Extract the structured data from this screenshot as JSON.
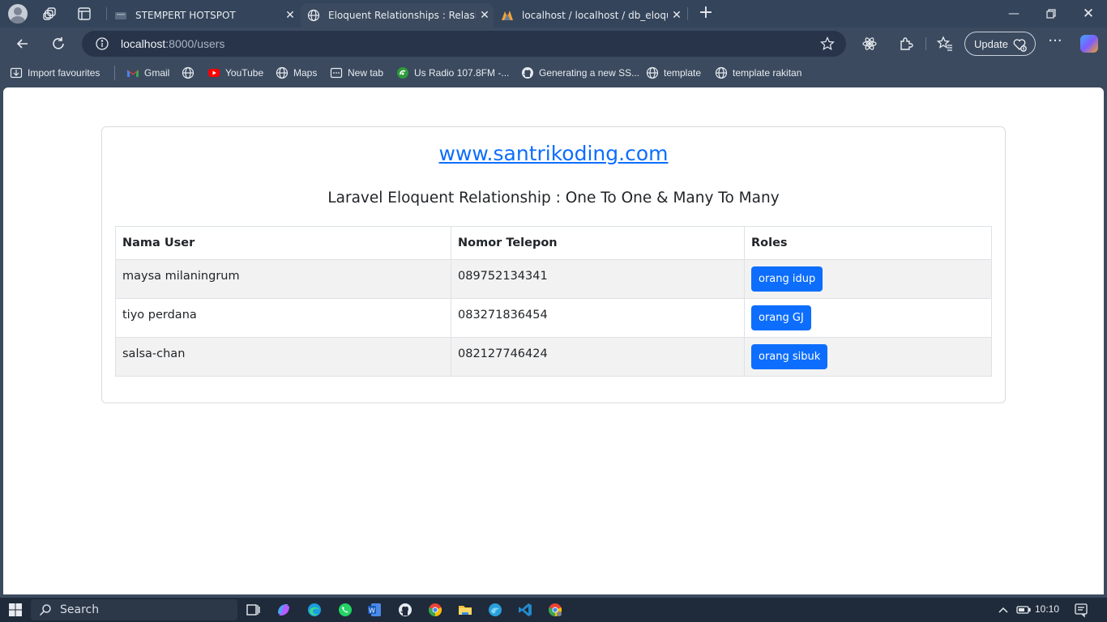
{
  "browser": {
    "tabs": [
      {
        "title": "STEMPERT HOTSPOT",
        "active": false
      },
      {
        "title": "Eloquent Relationships : Relasi One",
        "active": true
      },
      {
        "title": "localhost / localhost / db_eloquent",
        "active": false
      }
    ],
    "address": {
      "host": "localhost",
      "path": ":8000/users"
    },
    "update_label": "Update",
    "favourites": [
      {
        "label": "Import favourites",
        "icon": "import-icon"
      },
      {
        "label": "Gmail",
        "icon": "gmail-icon"
      },
      {
        "label": "",
        "icon": "globe-icon"
      },
      {
        "label": "YouTube",
        "icon": "youtube-icon"
      },
      {
        "label": "Maps",
        "icon": "globe-icon"
      },
      {
        "label": "New tab",
        "icon": "newtab-icon"
      },
      {
        "label": "Us Radio 107.8FM -...",
        "icon": "radio-icon"
      },
      {
        "label": "Generating a new SS...",
        "icon": "github-icon"
      },
      {
        "label": "template",
        "icon": "globe-icon"
      },
      {
        "label": "template rakitan",
        "icon": "globe-icon"
      }
    ]
  },
  "page": {
    "site_link": "www.santrikoding.com",
    "subtitle": "Laravel Eloquent Relationship : One To One & Many To Many",
    "table": {
      "headers": [
        "Nama User",
        "Nomor Telepon",
        "Roles"
      ],
      "rows": [
        {
          "name": "maysa milaningrum",
          "phone": "089752134341",
          "role": "orang idup"
        },
        {
          "name": "tiyo perdana",
          "phone": "083271836454",
          "role": "orang GJ"
        },
        {
          "name": "salsa-chan",
          "phone": "082127746424",
          "role": "orang sibuk"
        }
      ]
    },
    "colors": {
      "link": "#0d6efd",
      "role_button": "#0d6efd"
    }
  },
  "taskbar": {
    "search_label": "Search",
    "time": "10:10"
  }
}
